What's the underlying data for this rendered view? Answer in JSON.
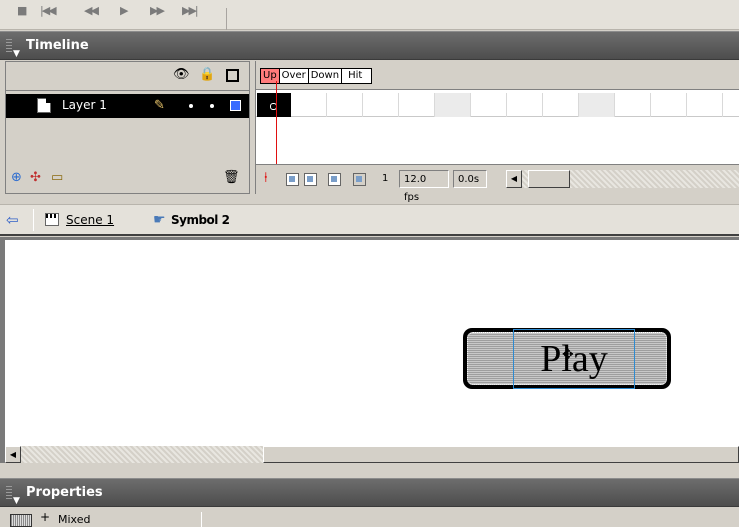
{
  "transport": {
    "glyphs": [
      "■",
      "|◀◀",
      "◀◀",
      "▶",
      "▶▶",
      "▶▶|"
    ]
  },
  "timeline": {
    "title": "Timeline",
    "layer_header_icons": [
      "eye-icon",
      "lock-icon",
      "outline-icon"
    ],
    "layers": [
      {
        "name": "Layer 1",
        "color": "#3a6bff"
      }
    ],
    "frame_labels": [
      "Up",
      "Over",
      "Down",
      "Hit"
    ],
    "selected_frame_label": "Up",
    "current_frame": "1",
    "frame_rate": "12.0 fps",
    "elapsed_time": "0.0s"
  },
  "editbar": {
    "scene_link": "Scene 1",
    "symbol_name": "Symbol 2"
  },
  "stage": {
    "button_text": "Play"
  },
  "properties": {
    "title": "Properties",
    "partial_label": "Mixed"
  }
}
